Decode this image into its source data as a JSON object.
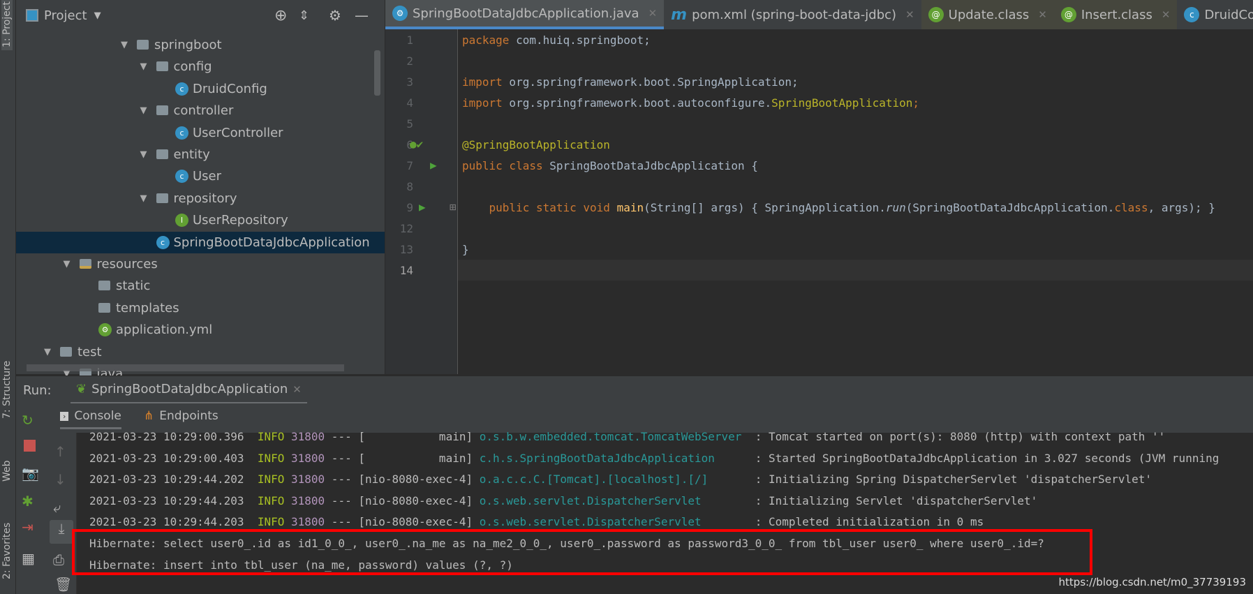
{
  "left_strip": {
    "project": "1: Project",
    "structure": "7: Structure",
    "web": "Web",
    "favorites": "2: Favorites"
  },
  "project_panel": {
    "title": "Project",
    "tree": [
      {
        "label": "springboot",
        "level": 4,
        "type": "package",
        "expanded": true
      },
      {
        "label": "config",
        "level": 5,
        "type": "package",
        "expanded": true
      },
      {
        "label": "DruidConfig",
        "level": 6,
        "type": "class"
      },
      {
        "label": "controller",
        "level": 5,
        "type": "package",
        "expanded": true
      },
      {
        "label": "UserController",
        "level": 6,
        "type": "class"
      },
      {
        "label": "entity",
        "level": 5,
        "type": "package",
        "expanded": true
      },
      {
        "label": "User",
        "level": 6,
        "type": "class"
      },
      {
        "label": "repository",
        "level": 5,
        "type": "package",
        "expanded": true
      },
      {
        "label": "UserRepository",
        "level": 6,
        "type": "interface"
      },
      {
        "label": "SpringBootDataJdbcApplication",
        "level": 5,
        "type": "spring-class",
        "selected": true
      },
      {
        "label": "resources",
        "level": 1,
        "type": "resources",
        "expanded": true
      },
      {
        "label": "static",
        "level": 2,
        "type": "folder"
      },
      {
        "label": "templates",
        "level": 2,
        "type": "folder"
      },
      {
        "label": "application.yml",
        "level": 2,
        "type": "yml"
      },
      {
        "label": "test",
        "level": 0,
        "type": "folder",
        "expanded": true
      },
      {
        "label": "java",
        "level": 1,
        "type": "folder",
        "expanded": true
      }
    ]
  },
  "editor": {
    "tabs": [
      {
        "label": "SpringBootDataJdbcApplication.java",
        "icon": "spring-class",
        "active": true
      },
      {
        "label": "pom.xml (spring-boot-data-jdbc)",
        "icon": "maven"
      },
      {
        "label": "Update.class",
        "icon": "annotation"
      },
      {
        "label": "Insert.class",
        "icon": "annotation"
      },
      {
        "label": "DruidConfig",
        "icon": "class"
      }
    ],
    "line_numbers": [
      "1",
      "2",
      "3",
      "4",
      "5",
      "6",
      "7",
      "8",
      "9",
      "12",
      "13",
      "14"
    ],
    "code": {
      "l1a": "package",
      "l1b": " com.huiq.springboot;",
      "l3a": "import",
      "l3b": " org.springframework.boot.SpringApplication;",
      "l4a": "import",
      "l4b": " org.springframework.boot.autoconfigure.",
      "l4c": "SpringBootApplication",
      ";": ";",
      "l6": "@SpringBootApplication",
      "l7a": "public class",
      "l7b": " SpringBootDataJdbcApplication {",
      "l9a": "    public static void ",
      "l9b": "main",
      "l9c": "(String[] args) { SpringApplication.",
      "l9d": "run",
      "l9e": "(SpringBootDataJdbcApplication.",
      "l9f": "class",
      "l9g": ", args); }",
      "l13": "}"
    }
  },
  "run": {
    "label": "Run:",
    "config": "SpringBootDataJdbcApplication",
    "tabs": [
      "Console",
      "Endpoints"
    ]
  },
  "console": {
    "lines": [
      {
        "ts": "2021-03-23 10:29:00.396",
        "level": "INFO",
        "pid": "31800",
        "thread": " --- [           main] ",
        "logger": "o.s.b.w.embedded.tomcat.TomcatWebServer  ",
        "msg": ": Tomcat started on port(s): 8080 (http) with context path ''"
      },
      {
        "ts": "2021-03-23 10:29:00.403",
        "level": "INFO",
        "pid": "31800",
        "thread": " --- [           main] ",
        "logger": "c.h.s.SpringBootDataJdbcApplication      ",
        "msg": ": Started SpringBootDataJdbcApplication in 3.027 seconds (JVM running"
      },
      {
        "ts": "2021-03-23 10:29:44.202",
        "level": "INFO",
        "pid": "31800",
        "thread": " --- [nio-8080-exec-4] ",
        "logger": "o.a.c.c.C.[Tomcat].[localhost].[/]       ",
        "msg": ": Initializing Spring DispatcherServlet 'dispatcherServlet'"
      },
      {
        "ts": "2021-03-23 10:29:44.203",
        "level": "INFO",
        "pid": "31800",
        "thread": " --- [nio-8080-exec-4] ",
        "logger": "o.s.web.servlet.DispatcherServlet        ",
        "msg": ": Initializing Servlet 'dispatcherServlet'"
      },
      {
        "ts": "2021-03-23 10:29:44.203",
        "level": "INFO",
        "pid": "31800",
        "thread": " --- [nio-8080-exec-4] ",
        "logger": "o.s.web.servlet.DispatcherServlet        ",
        "msg": ": Completed initialization in 0 ms"
      }
    ],
    "hibernate": [
      "Hibernate: select user0_.id as id1_0_0_, user0_.na_me as na_me2_0_0_, user0_.password as password3_0_0_ from tbl_user user0_ where user0_.id=?",
      "Hibernate: insert into tbl_user (na_me, password) values (?, ?)"
    ]
  },
  "watermark": "https://blog.csdn.net/m0_37739193",
  "colors": {
    "highlight_box": "#ff0000",
    "selection": "#0d293e",
    "accent": "#4a88c7"
  }
}
